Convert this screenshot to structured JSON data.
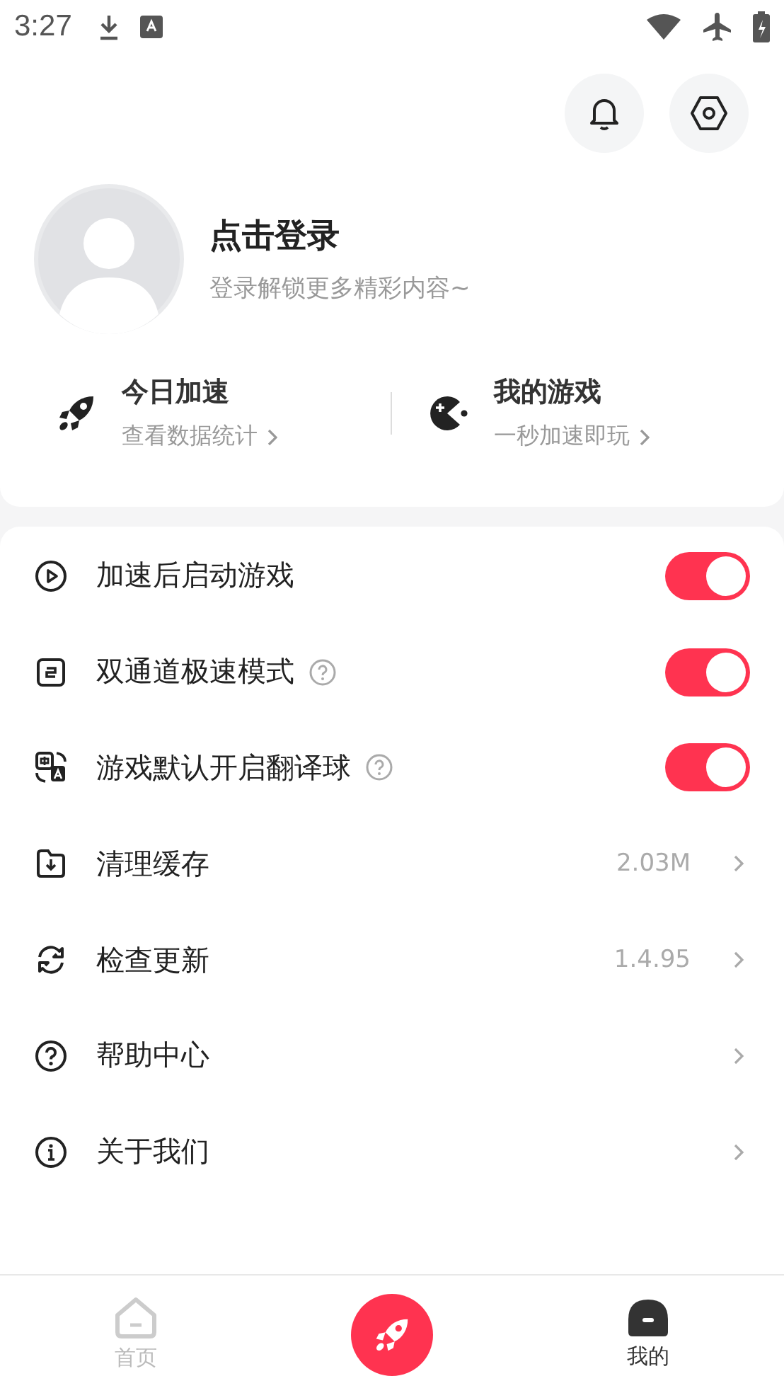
{
  "status_bar": {
    "time": "3:27"
  },
  "profile": {
    "title": "点击登录",
    "subtitle": "登录解锁更多精彩内容~"
  },
  "stats": [
    {
      "kind": "rocket",
      "title": "今日加速",
      "subtitle": "查看数据统计"
    },
    {
      "kind": "game",
      "title": "我的游戏",
      "subtitle": "一秒加速即玩"
    }
  ],
  "settings": [
    {
      "kind": "toggle",
      "label": "加速后启动游戏",
      "help": false,
      "on": true
    },
    {
      "kind": "toggle",
      "label": "双通道极速模式",
      "help": true,
      "on": true
    },
    {
      "kind": "toggle",
      "label": "游戏默认开启翻译球",
      "help": true,
      "on": true
    },
    {
      "kind": "link",
      "label": "清理缓存",
      "value": "2.03M"
    },
    {
      "kind": "link",
      "label": "检查更新",
      "value": "1.4.95"
    },
    {
      "kind": "link",
      "label": "帮助中心"
    },
    {
      "kind": "link",
      "label": "关于我们"
    }
  ],
  "nav": [
    {
      "kind": "home",
      "label": "首页",
      "selected": false
    },
    {
      "kind": "boost"
    },
    {
      "kind": "me",
      "label": "我的",
      "selected": true
    }
  ]
}
